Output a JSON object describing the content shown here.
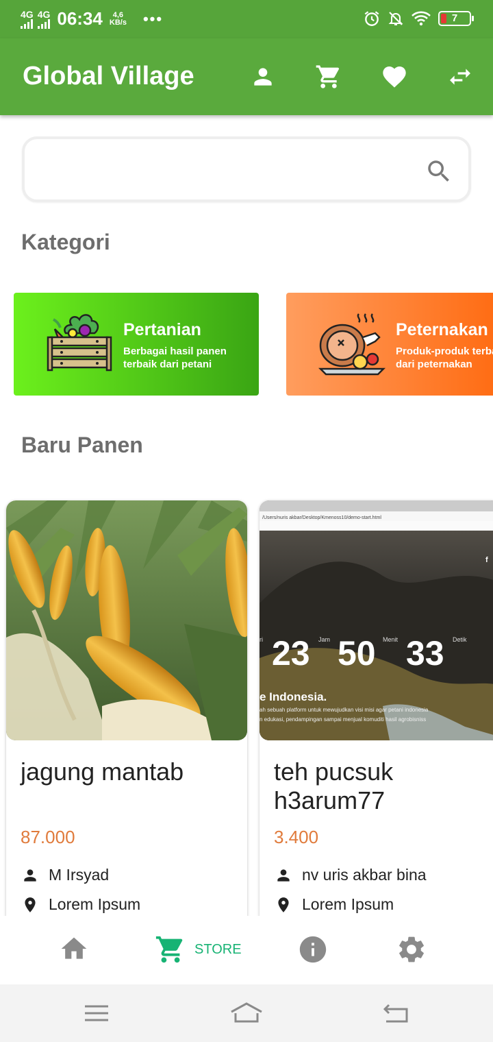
{
  "status_bar": {
    "net1": "4G",
    "net2": "4G",
    "time": "06:34",
    "speed_value": "4,6",
    "speed_unit": "KB/s",
    "overflow": "•••",
    "battery_level": "7",
    "icons": [
      "alarm-icon",
      "mute-notifications-icon",
      "wifi-icon",
      "battery-icon"
    ]
  },
  "app_bar": {
    "title": "Global Village",
    "icons": [
      "person-icon",
      "cart-icon",
      "heart-icon",
      "swap-icon"
    ]
  },
  "search": {
    "placeholder": "",
    "value": ""
  },
  "sections": {
    "categories_title": "Kategori",
    "new_harvest_title": "Baru Panen"
  },
  "categories": [
    {
      "name": "Pertanian",
      "desc_line1": "Berbagai hasil panen",
      "desc_line2": "terbaik dari petani",
      "color_start": "#6cf01c",
      "color_end": "#3aa514",
      "icon": "vegetable-crate-icon"
    },
    {
      "name": "Peternakan",
      "desc_line1": "Produk-produk terbaik",
      "desc_line2": "dari peternakan",
      "color_start": "#ff9d5e",
      "color_end": "#ff6a10",
      "icon": "roast-ham-icon"
    }
  ],
  "products": [
    {
      "name": "jagung mantab",
      "price": "87.000",
      "seller": "M Irsyad",
      "location": "Lorem Ipsum",
      "image": "corn-photo"
    },
    {
      "name": "teh pucsuk h3arum77",
      "price": "3.400",
      "seller": "nv uris akbar bina",
      "location": "Lorem Ipsum",
      "image": "website-screenshot",
      "image_texts": {
        "countdown": [
          "23",
          "50",
          "33"
        ],
        "countdown_labels": [
          "ri",
          "Jam",
          "Menit",
          "Detik"
        ],
        "headline": "e Indonesia.",
        "body1": "ah sebuah platform untuk mewujudkan visi misi agar petani indonesia",
        "body2": "n edukasi, pendampingan sampai menjual komuditi hasil agrobisniss",
        "url": "/Users/nuris akbar/Desktop/Kmenoss10/demo-start.html",
        "social": "f"
      }
    }
  ],
  "bottom_nav": {
    "items": [
      {
        "icon": "home-icon",
        "label": ""
      },
      {
        "icon": "store-cart-icon",
        "label": "STORE"
      },
      {
        "icon": "info-icon",
        "label": ""
      },
      {
        "icon": "settings-icon",
        "label": ""
      }
    ],
    "active_color": "#17b374",
    "inactive_color": "#8a8a8a"
  },
  "system_nav": {
    "icons": [
      "menu-icon",
      "home-outline-icon",
      "back-icon"
    ]
  },
  "colors": {
    "primary": "#5aaa3d",
    "status_bar": "#56a53a",
    "price": "#e07b3c"
  }
}
